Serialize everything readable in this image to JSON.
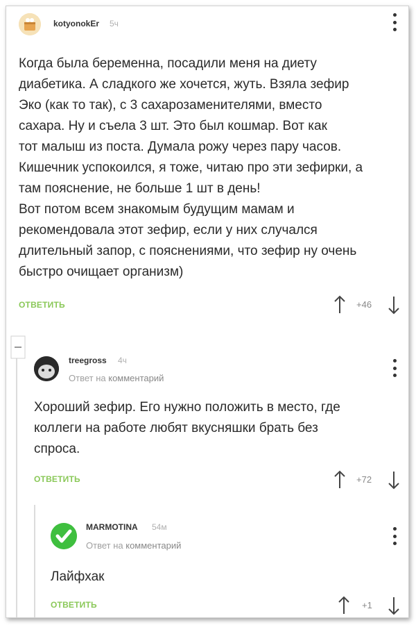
{
  "comments": [
    {
      "user": "kotyonokEr",
      "time": "5ч",
      "avatar": "cat-avatar",
      "text": "Когда была беременна, посадили меня на диету\nдиабетика. А сладкого же хочется, жуть. Взяла зефир\nЭко (как то так), с 3 сахарозаменителями, вместо\nсахара. Ну и съела 3 шт. Это был кошмар. Вот как\nтот малыш из поста. Думала рожу через пару часов.\nКишечник успокоился, я тоже, читаю про эти зефирки, а\nтам пояснение, не больше 1 шт в день!\nВот потом всем знакомым будущим мамам и\nрекомендовала этот зефир, если у них случался\nдлительный запор, с пояснениями, что зефир ну очень\nбыстро очищает организм)",
      "reply_label": "ОТВЕТИТЬ",
      "rating": "+46"
    },
    {
      "user": "treegross",
      "time": "4ч",
      "avatar": "photo-avatar",
      "reply_to_prefix": "Ответ на",
      "reply_to_target": "комментарий",
      "text": "Хороший зефир. Его нужно положить в место, где\nколлеги на работе любят вкусняшки брать без\nспроса.",
      "reply_label": "ОТВЕТИТЬ",
      "rating": "+72"
    },
    {
      "user": "MARMOTINA",
      "time": "54м",
      "avatar": "check-avatar",
      "reply_to_prefix": "Ответ на",
      "reply_to_target": "комментарий",
      "text": "Лайфхак",
      "reply_label": "ОТВЕТИТЬ",
      "rating": "+1"
    }
  ],
  "colors": {
    "reply_link": "#8ac858",
    "check_avatar": "#3fbf3f"
  },
  "icons": [
    "more-icon",
    "arrow-up-icon",
    "arrow-down-icon",
    "collapse-icon"
  ]
}
